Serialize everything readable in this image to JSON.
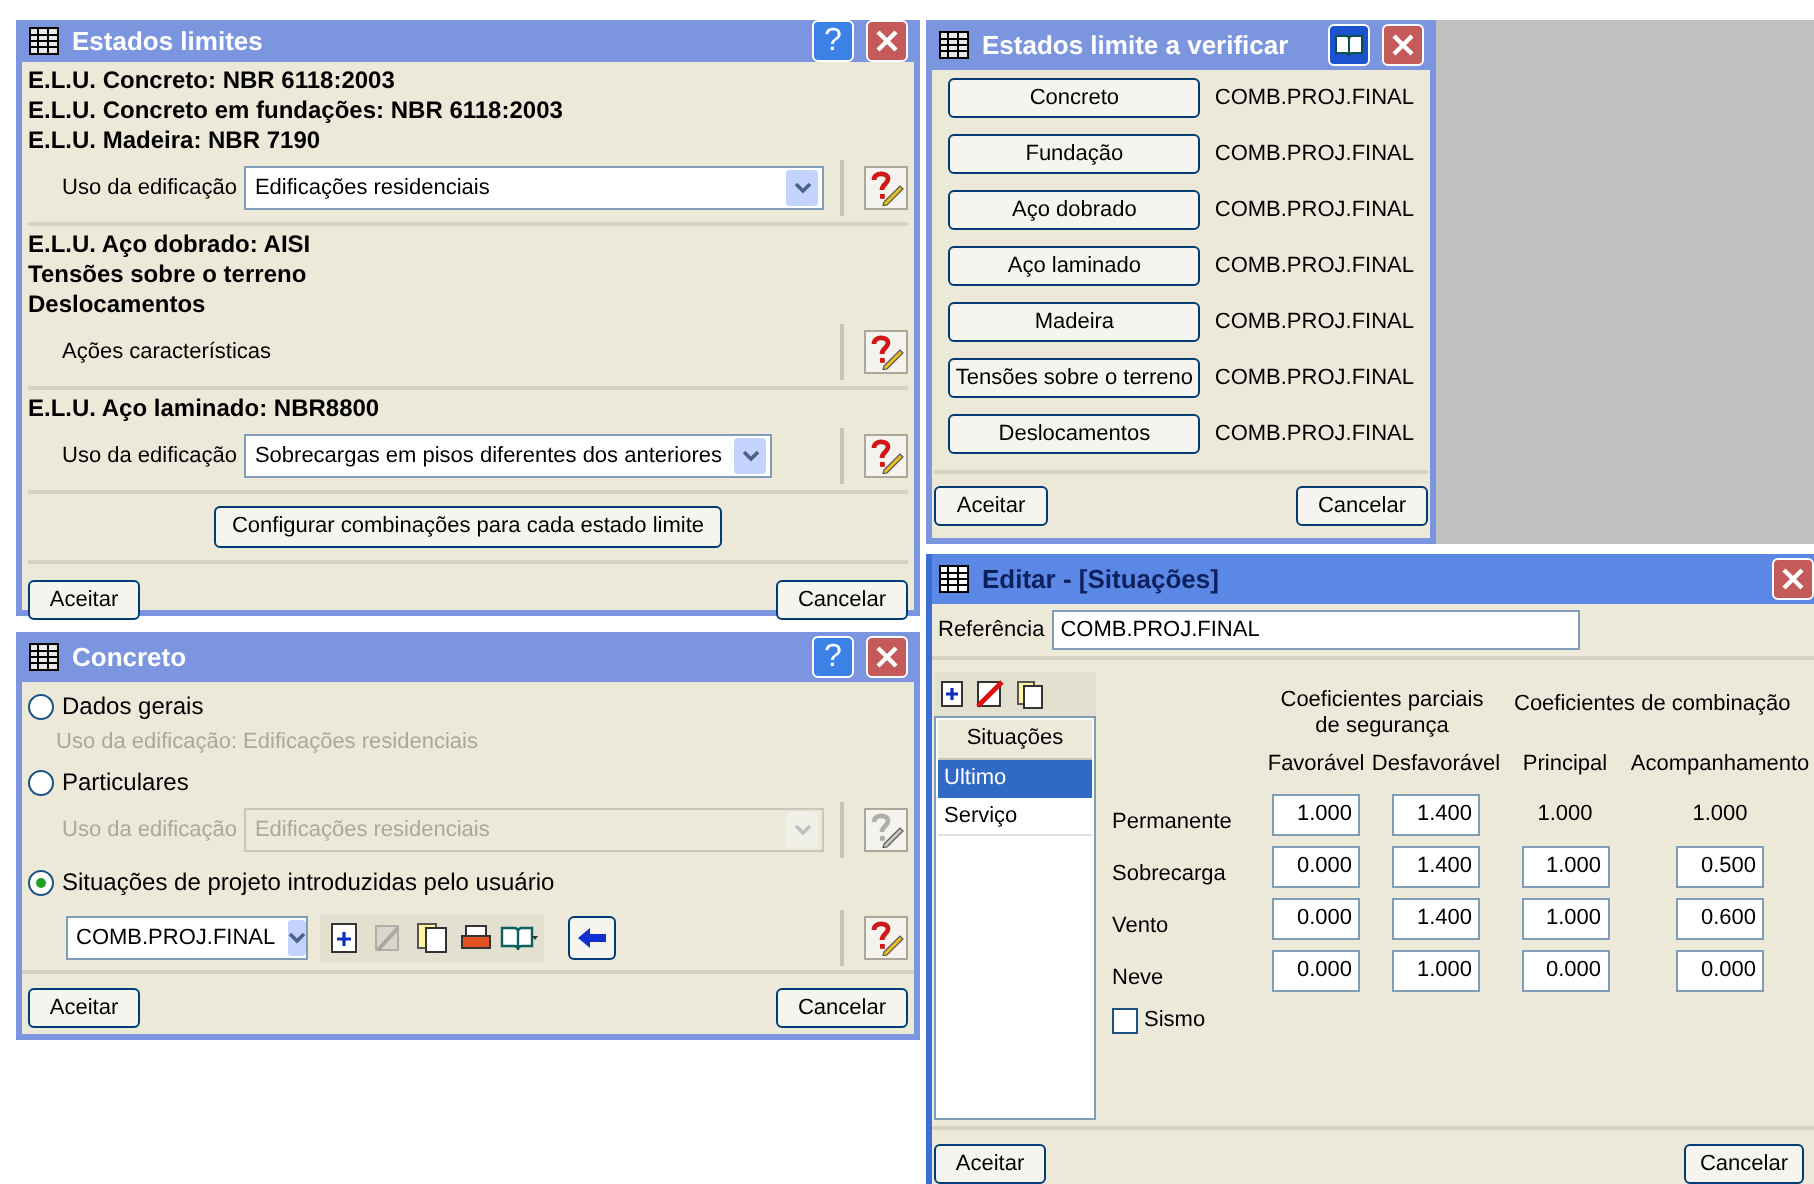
{
  "estados_limites": {
    "title": "Estados limites",
    "help": "?",
    "sections": [
      {
        "kind": "select",
        "headings": [
          "E.L.U. Concreto: NBR 6118:2003",
          "E.L.U. Concreto em fundações: NBR 6118:2003",
          "E.L.U. Madeira: NBR 7190"
        ],
        "label": "Uso da edificação",
        "value": "Edificações residenciais"
      },
      {
        "kind": "text",
        "headings": [
          "E.L.U. Aço dobrado: AISI",
          "Tensões sobre o terreno",
          "Deslocamentos"
        ],
        "label": "Ações características"
      },
      {
        "kind": "select",
        "headings": [
          "E.L.U. Aço laminado: NBR8800"
        ],
        "label": "Uso da edificação",
        "value": "Sobrecargas em pisos diferentes dos anteriores"
      }
    ],
    "configure": "Configurar combinações para cada estado limite",
    "accept": "Aceitar",
    "cancel": "Cancelar"
  },
  "concreto": {
    "title": "Concreto",
    "help": "?",
    "options": [
      {
        "kind": "note",
        "label": "Dados gerais",
        "selected": false,
        "text": "Uso da edificação: Edificações residenciais"
      },
      {
        "kind": "select",
        "label": "Particulares",
        "selected": false,
        "field": {
          "label": "Uso da edificação",
          "value": "Edificações residenciais"
        }
      },
      {
        "kind": "combo",
        "label": "Situações de projeto introduzidas pelo usuário",
        "selected": true,
        "value": "COMB.PROJ.FINAL"
      }
    ],
    "accept": "Aceitar",
    "cancel": "Cancelar"
  },
  "verificar": {
    "title": "Estados limite a verificar",
    "rows": [
      {
        "button": "Concreto",
        "value": "COMB.PROJ.FINAL"
      },
      {
        "button": "Fundação",
        "value": "COMB.PROJ.FINAL"
      },
      {
        "button": "Aço dobrado",
        "value": "COMB.PROJ.FINAL"
      },
      {
        "button": "Aço laminado",
        "value": "COMB.PROJ.FINAL"
      },
      {
        "button": "Madeira",
        "value": "COMB.PROJ.FINAL"
      },
      {
        "button": "Tensões sobre o terreno",
        "value": "COMB.PROJ.FINAL"
      },
      {
        "button": "Deslocamentos",
        "value": "COMB.PROJ.FINAL"
      }
    ],
    "accept": "Aceitar",
    "cancel": "Cancelar"
  },
  "editar": {
    "title": "Editar - [Situações]",
    "reference_label": "Referência",
    "reference": "COMB.PROJ.FINAL",
    "list_header": "Situações",
    "situations": [
      {
        "label": "Ultimo",
        "selected": true
      },
      {
        "label": "Serviço",
        "selected": false
      }
    ],
    "groups": [
      "Coeficientes parciais de segurança",
      "Coeficientes de combinação"
    ],
    "columns": [
      "Favorável",
      "Desfavorável",
      "Principal",
      "Acompanhamento"
    ],
    "rows": [
      {
        "label": "Permanente",
        "cells": [
          {
            "kind": "field",
            "value": "1.000"
          },
          {
            "kind": "field",
            "value": "1.400"
          },
          {
            "kind": "text",
            "value": "1.000"
          },
          {
            "kind": "text",
            "value": "1.000"
          }
        ]
      },
      {
        "label": "Sobrecarga",
        "cells": [
          {
            "kind": "field",
            "value": "0.000"
          },
          {
            "kind": "field",
            "value": "1.400"
          },
          {
            "kind": "field",
            "value": "1.000"
          },
          {
            "kind": "field",
            "value": "0.500"
          }
        ]
      },
      {
        "label": "Vento",
        "cells": [
          {
            "kind": "field",
            "value": "0.000"
          },
          {
            "kind": "field",
            "value": "1.400"
          },
          {
            "kind": "field",
            "value": "1.000"
          },
          {
            "kind": "field",
            "value": "0.600"
          }
        ]
      },
      {
        "label": "Neve",
        "cells": [
          {
            "kind": "field",
            "value": "0.000"
          },
          {
            "kind": "field",
            "value": "1.000"
          },
          {
            "kind": "field",
            "value": "0.000"
          },
          {
            "kind": "field",
            "value": "0.000"
          }
        ]
      }
    ],
    "sismo": {
      "label": "Sismo",
      "checked": false
    },
    "accept": "Aceitar",
    "cancel": "Cancelar"
  }
}
